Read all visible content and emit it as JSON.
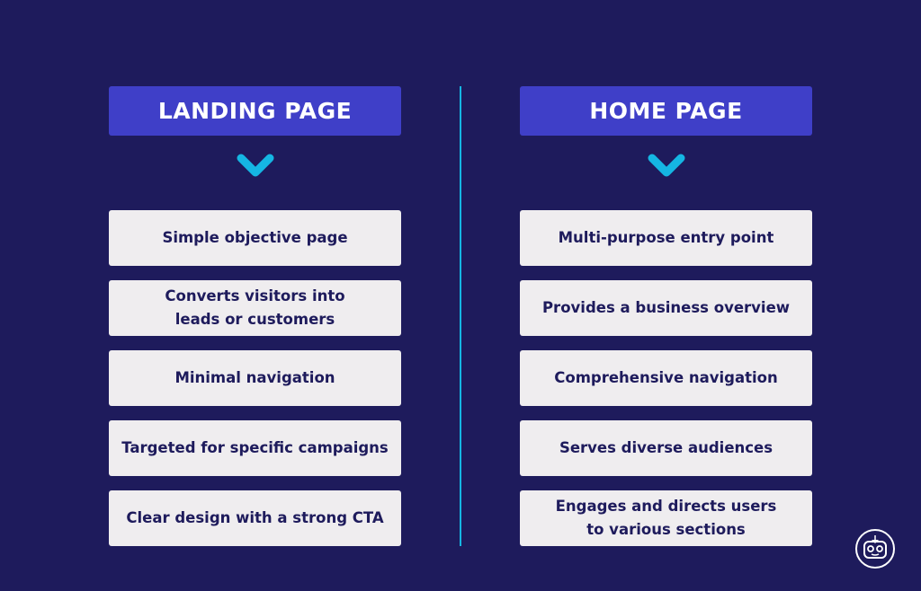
{
  "left": {
    "title": "LANDING PAGE",
    "items": [
      "Simple objective page",
      "Converts visitors into\nleads or customers",
      "Minimal navigation",
      "Targeted for specific campaigns",
      "Clear design with a strong CTA"
    ]
  },
  "right": {
    "title": "HOME PAGE",
    "items": [
      "Multi-purpose entry point",
      "Provides a business overview",
      "Comprehensive navigation",
      "Serves diverse audiences",
      "Engages and directs users\nto various sections"
    ]
  },
  "colors": {
    "background": "#1e1b5c",
    "header": "#3f3fc8",
    "accent": "#15b6e3",
    "item_bg": "#efedef"
  },
  "icons": {
    "arrow": "chevron-down-icon",
    "logo": "robot-logo-icon"
  }
}
